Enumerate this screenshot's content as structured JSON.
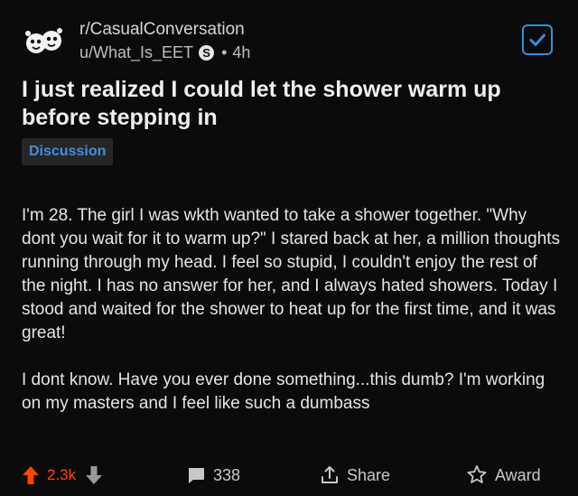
{
  "post": {
    "subreddit": "r/CasualConversation",
    "author": "u/What_Is_EET",
    "author_badge": "S",
    "separator": "•",
    "age": "4h",
    "title": "I just realized I could let the shower warm up before stepping in",
    "flair": "Discussion",
    "body": [
      "I'm 28. The girl I was wkth wanted to take a shower together. \"Why dont you wait for it to warm up?\"  I stared back at her, a million thoughts running through my head. I feel so stupid, I couldn't enjoy the rest of the night. I has no answer for her, and I always hated showers. Today I stood and waited for the shower to heat up for the first time, and it was great!",
      "I dont know. Have you ever done something...this dumb? I'm working on my masters and I feel like such a dumbass"
    ]
  },
  "actions": {
    "score": "2.3k",
    "comments": "338",
    "share_label": "Share",
    "award_label": "Award"
  },
  "colors": {
    "upvote": "#ff4500",
    "accent": "#3a8bd7",
    "background": "#0b0b0b"
  },
  "icons": [
    "subreddit-avatar-icon",
    "save-check-icon",
    "upvote-arrow-icon",
    "downvote-arrow-icon",
    "comment-bubble-icon",
    "share-icon",
    "award-icon"
  ]
}
